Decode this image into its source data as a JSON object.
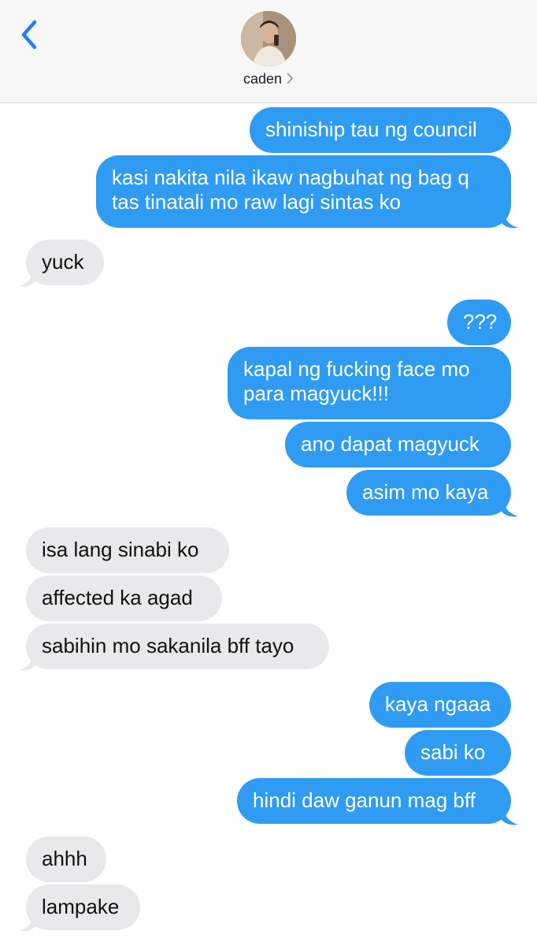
{
  "header": {
    "back_icon": "chevron-left-icon",
    "contact_name": "caden",
    "chevron_icon": "chevron-right-icon",
    "avatar_icon": "contact-photo"
  },
  "colors": {
    "sent_bubble": "#2f9bf3",
    "received_bubble": "#e9e9eb",
    "accent": "#1e82f0",
    "header_bg": "#f7f7f7"
  },
  "messages": [
    {
      "side": "sent",
      "text": "shiniship tau ng council"
    },
    {
      "side": "sent",
      "text": "kasi nakita nila ikaw nagbuhat ng bag q tas tinatali mo raw lagi sintas ko"
    },
    {
      "side": "received",
      "text": "yuck"
    },
    {
      "side": "sent",
      "text": "???"
    },
    {
      "side": "sent",
      "text": "kapal ng fucking face mo para magyuck!!!"
    },
    {
      "side": "sent",
      "text": "ano dapat magyuck"
    },
    {
      "side": "sent",
      "text": "asim mo kaya"
    },
    {
      "side": "received",
      "text": "isa lang sinabi ko"
    },
    {
      "side": "received",
      "text": "affected ka agad"
    },
    {
      "side": "received",
      "text": "sabihin mo sakanila bff tayo"
    },
    {
      "side": "sent",
      "text": "kaya ngaaa"
    },
    {
      "side": "sent",
      "text": "sabi ko"
    },
    {
      "side": "sent",
      "text": "hindi daw ganun mag bff"
    },
    {
      "side": "received",
      "text": "ahhh"
    },
    {
      "side": "received",
      "text": "lampake"
    }
  ]
}
